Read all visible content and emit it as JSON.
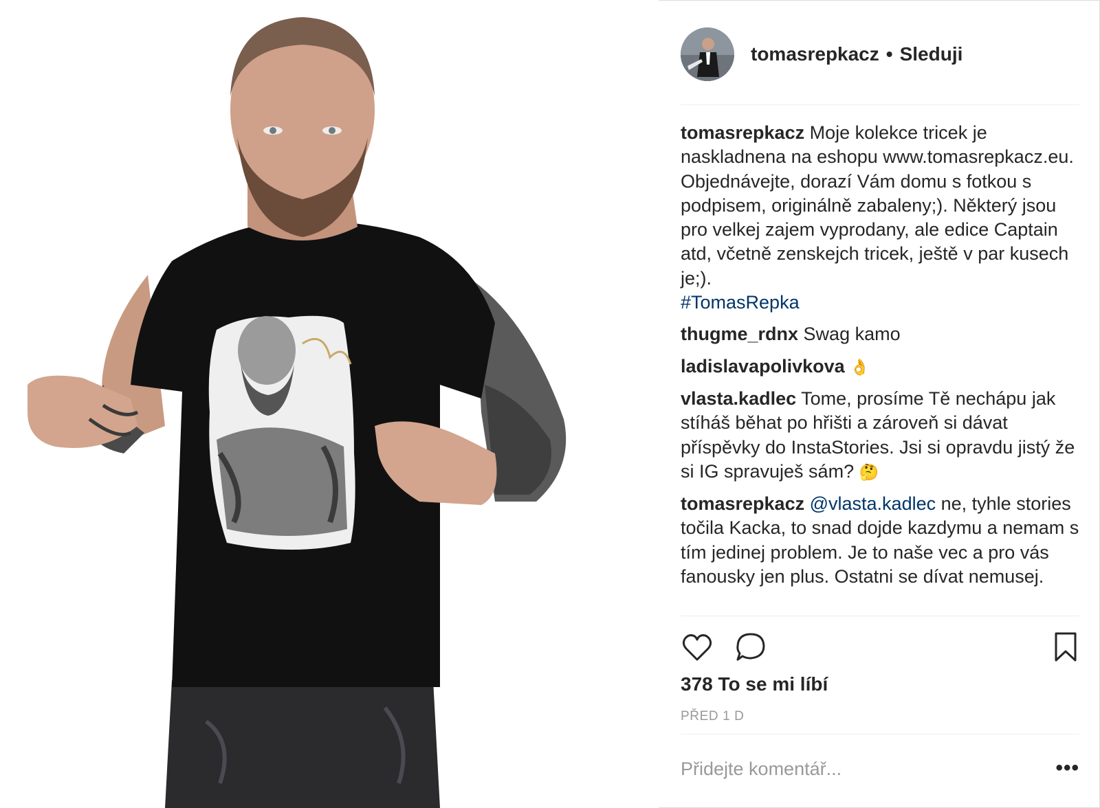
{
  "post": {
    "username": "tomasrepkacz",
    "separator": "•",
    "follow_label": "Sleduji"
  },
  "comments": [
    {
      "user": "tomasrepkacz",
      "text": "Moje kolekce tricek je naskladnena na eshopu www.tomasrepkacz.eu. Objednávejte, dorazí Vám domu s fotkou s podpisem, originálně zabaleny;). Některý jsou pro velkej zajem vyprodany, ale edice Captain atd, včetně zenskejch tricek, ještě v par kusech je;).",
      "hashtag": "#TomasRepka"
    },
    {
      "user": "thugme_rdnx",
      "text": "Swag kamo"
    },
    {
      "user": "ladislavapolivkova",
      "emoji": "👌"
    },
    {
      "user": "vlasta.kadlec",
      "text": "Tome, prosíme Tě nechápu jak stíháš běhat po hřišti a zároveň si dávat příspěvky do InstaStories. Jsi si opravdu jistý že si IG spravuješ sám?",
      "emoji": "🤔"
    },
    {
      "user": "tomasrepkacz",
      "mention": "@vlasta.kadlec",
      "text": "ne, tyhle stories točila Kacka, to snad dojde kazdymu a nemam s tím jedinej problem. Je to naše vec a pro vás fanousky jen plus. Ostatni se dívat nemusej."
    }
  ],
  "actions": {
    "like_icon": "heart-icon",
    "comment_icon": "speech-bubble-icon",
    "save_icon": "bookmark-icon"
  },
  "likes_label": "378 To se mi líbí",
  "time_label": "PŘED 1 D",
  "add_comment_placeholder": "Přidejte komentář...",
  "more_label": "•••",
  "colors": {
    "link": "#003569",
    "text": "#262626",
    "muted": "#999999",
    "border": "#efefef"
  }
}
